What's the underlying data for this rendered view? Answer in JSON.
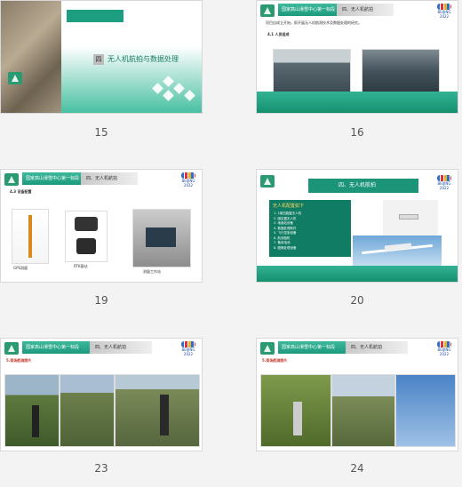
{
  "slides": [
    {
      "num": "15",
      "title": "无人机航拍与数据处理",
      "section": "四"
    },
    {
      "num": "16",
      "header": "国家高山滑雪中心第一标段",
      "section": "四、无人机航拍",
      "body": "项目自成立开始，即开展无人机航测技术及数据处理的研究。",
      "sub": "4.1 人员组成",
      "brand": "BEIJING 2022"
    },
    {
      "num": "19",
      "header": "国家高山滑雪中心第一标段",
      "section": "四、无人机航拍",
      "sub": "4.3 设备配置",
      "captions": [
        "GPS测量",
        "RTK基站",
        "测量工作站"
      ],
      "brand": "BEIJING 2022"
    },
    {
      "num": "20",
      "title": "四、无人机航拍",
      "list_title": "无人机配置如下",
      "items": [
        "1. 1架四旋翼无人机",
        "2. 固定翼无人机",
        "3. 地面站设备",
        "4. 数据处理软件",
        "5. 飞行控制设备",
        "6. 航测相机",
        "7. 备用电池",
        "8. 图像处理设备"
      ],
      "brand": "BEIJING 2022"
    },
    {
      "num": "23",
      "header": "国家高山滑雪中心第一标段",
      "section": "四、无人机航拍",
      "sub": "5.现场航测照片",
      "brand": "BEIJING 2022"
    },
    {
      "num": "24",
      "header": "国家高山滑雪中心第一标段",
      "section": "四、无人机航拍",
      "sub": "5.现场航测照片",
      "brand": "BEIJING 2022"
    }
  ]
}
